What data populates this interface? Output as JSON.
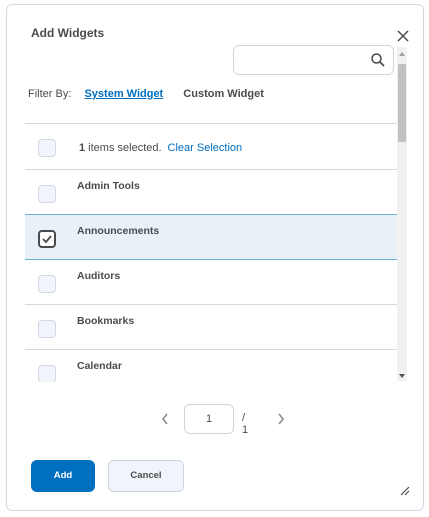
{
  "dialog": {
    "title": "Add Widgets",
    "search": {
      "value": "",
      "placeholder": ""
    },
    "filter": {
      "label": "Filter By:",
      "tabs": [
        {
          "label": "System Widget",
          "active": true
        },
        {
          "label": "Custom Widget",
          "active": false
        }
      ]
    },
    "selection": {
      "count": "1",
      "text": " items selected.",
      "clear_label": "Clear Selection"
    },
    "items": [
      {
        "label": "Admin Tools",
        "checked": false
      },
      {
        "label": "Announcements",
        "checked": true
      },
      {
        "label": "Auditors",
        "checked": false
      },
      {
        "label": "Bookmarks",
        "checked": false
      },
      {
        "label": "Calendar",
        "checked": false
      }
    ],
    "pager": {
      "current": "1",
      "total": "/ 1"
    },
    "buttons": {
      "add": "Add",
      "cancel": "Cancel"
    },
    "colors": {
      "primary": "#006fbf",
      "selected_row": "#e9f1f8",
      "border": "#d3d9e3"
    }
  }
}
